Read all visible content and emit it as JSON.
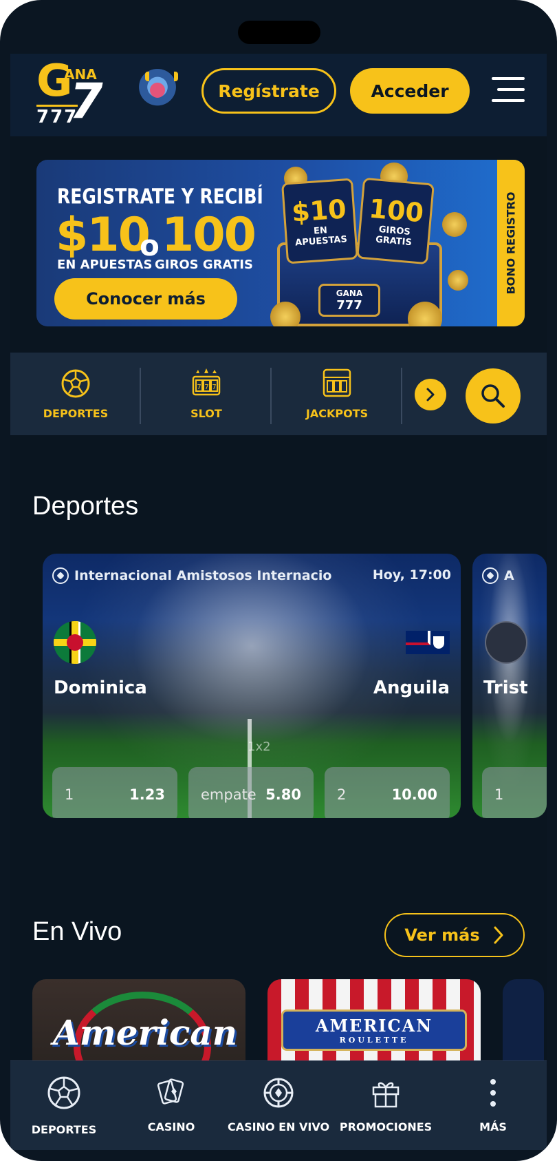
{
  "header": {
    "logo_ana": "ANA",
    "logo_g": "G",
    "logo_seven": "7",
    "logo_sevens": "777",
    "register_label": "Regístrate",
    "login_label": "Acceder"
  },
  "banner": {
    "headline": "REGISTRATE Y RECIBÍ",
    "amount1": "$10",
    "connector": "o",
    "amount2": "100",
    "sub1": "EN APUESTAS",
    "sub2": "GIROS GRATIS",
    "cta_label": "Conocer más",
    "side_tab": "BONO REGISTRO",
    "card1_big": "$10",
    "card1_small": "EN APUESTAS",
    "card2_big": "100",
    "card2_small": "GIROS GRATIS",
    "plate_top": "GANA",
    "plate_bottom": "777"
  },
  "categories": [
    {
      "label": "DEPORTES",
      "icon": "soccer-ball-icon"
    },
    {
      "label": "SLOT",
      "icon": "slot-machine-icon"
    },
    {
      "label": "JACKPOTS",
      "icon": "jackpot-icon"
    }
  ],
  "sports": {
    "title": "Deportes",
    "matches": [
      {
        "league": "Internacional  Amistosos Internacio",
        "time": "Hoy, 17:00",
        "home": "Dominica",
        "away": "Anguila",
        "market": "1x2",
        "odds": [
          {
            "key": "1",
            "value": "1.23"
          },
          {
            "key": "empate",
            "value": "5.80"
          },
          {
            "key": "2",
            "value": "10.00"
          }
        ]
      },
      {
        "league": "A",
        "home": "Trist",
        "odds": [
          {
            "key": "1",
            "value": ""
          }
        ]
      }
    ]
  },
  "live": {
    "title": "En Vivo",
    "see_more_label": "Ver más",
    "cards": [
      {
        "logo": "American"
      },
      {
        "title": "AMERICAN",
        "subtitle": "ROULETTE"
      },
      {
        "logo": ""
      }
    ]
  },
  "bottom_nav": [
    {
      "label": "DEPORTES",
      "icon": "soccer-ball-icon"
    },
    {
      "label": "CASINO",
      "icon": "cards-icon"
    },
    {
      "label": "CASINO EN VIVO",
      "icon": "casino-chip-icon"
    },
    {
      "label": "PROMOCIONES",
      "icon": "gift-icon"
    },
    {
      "label": "MÁS",
      "icon": "more-vertical-icon"
    }
  ],
  "colors": {
    "accent": "#f7c21a",
    "background": "#0a1520",
    "header": "#0d1e33",
    "nav": "#1a2a3d"
  }
}
